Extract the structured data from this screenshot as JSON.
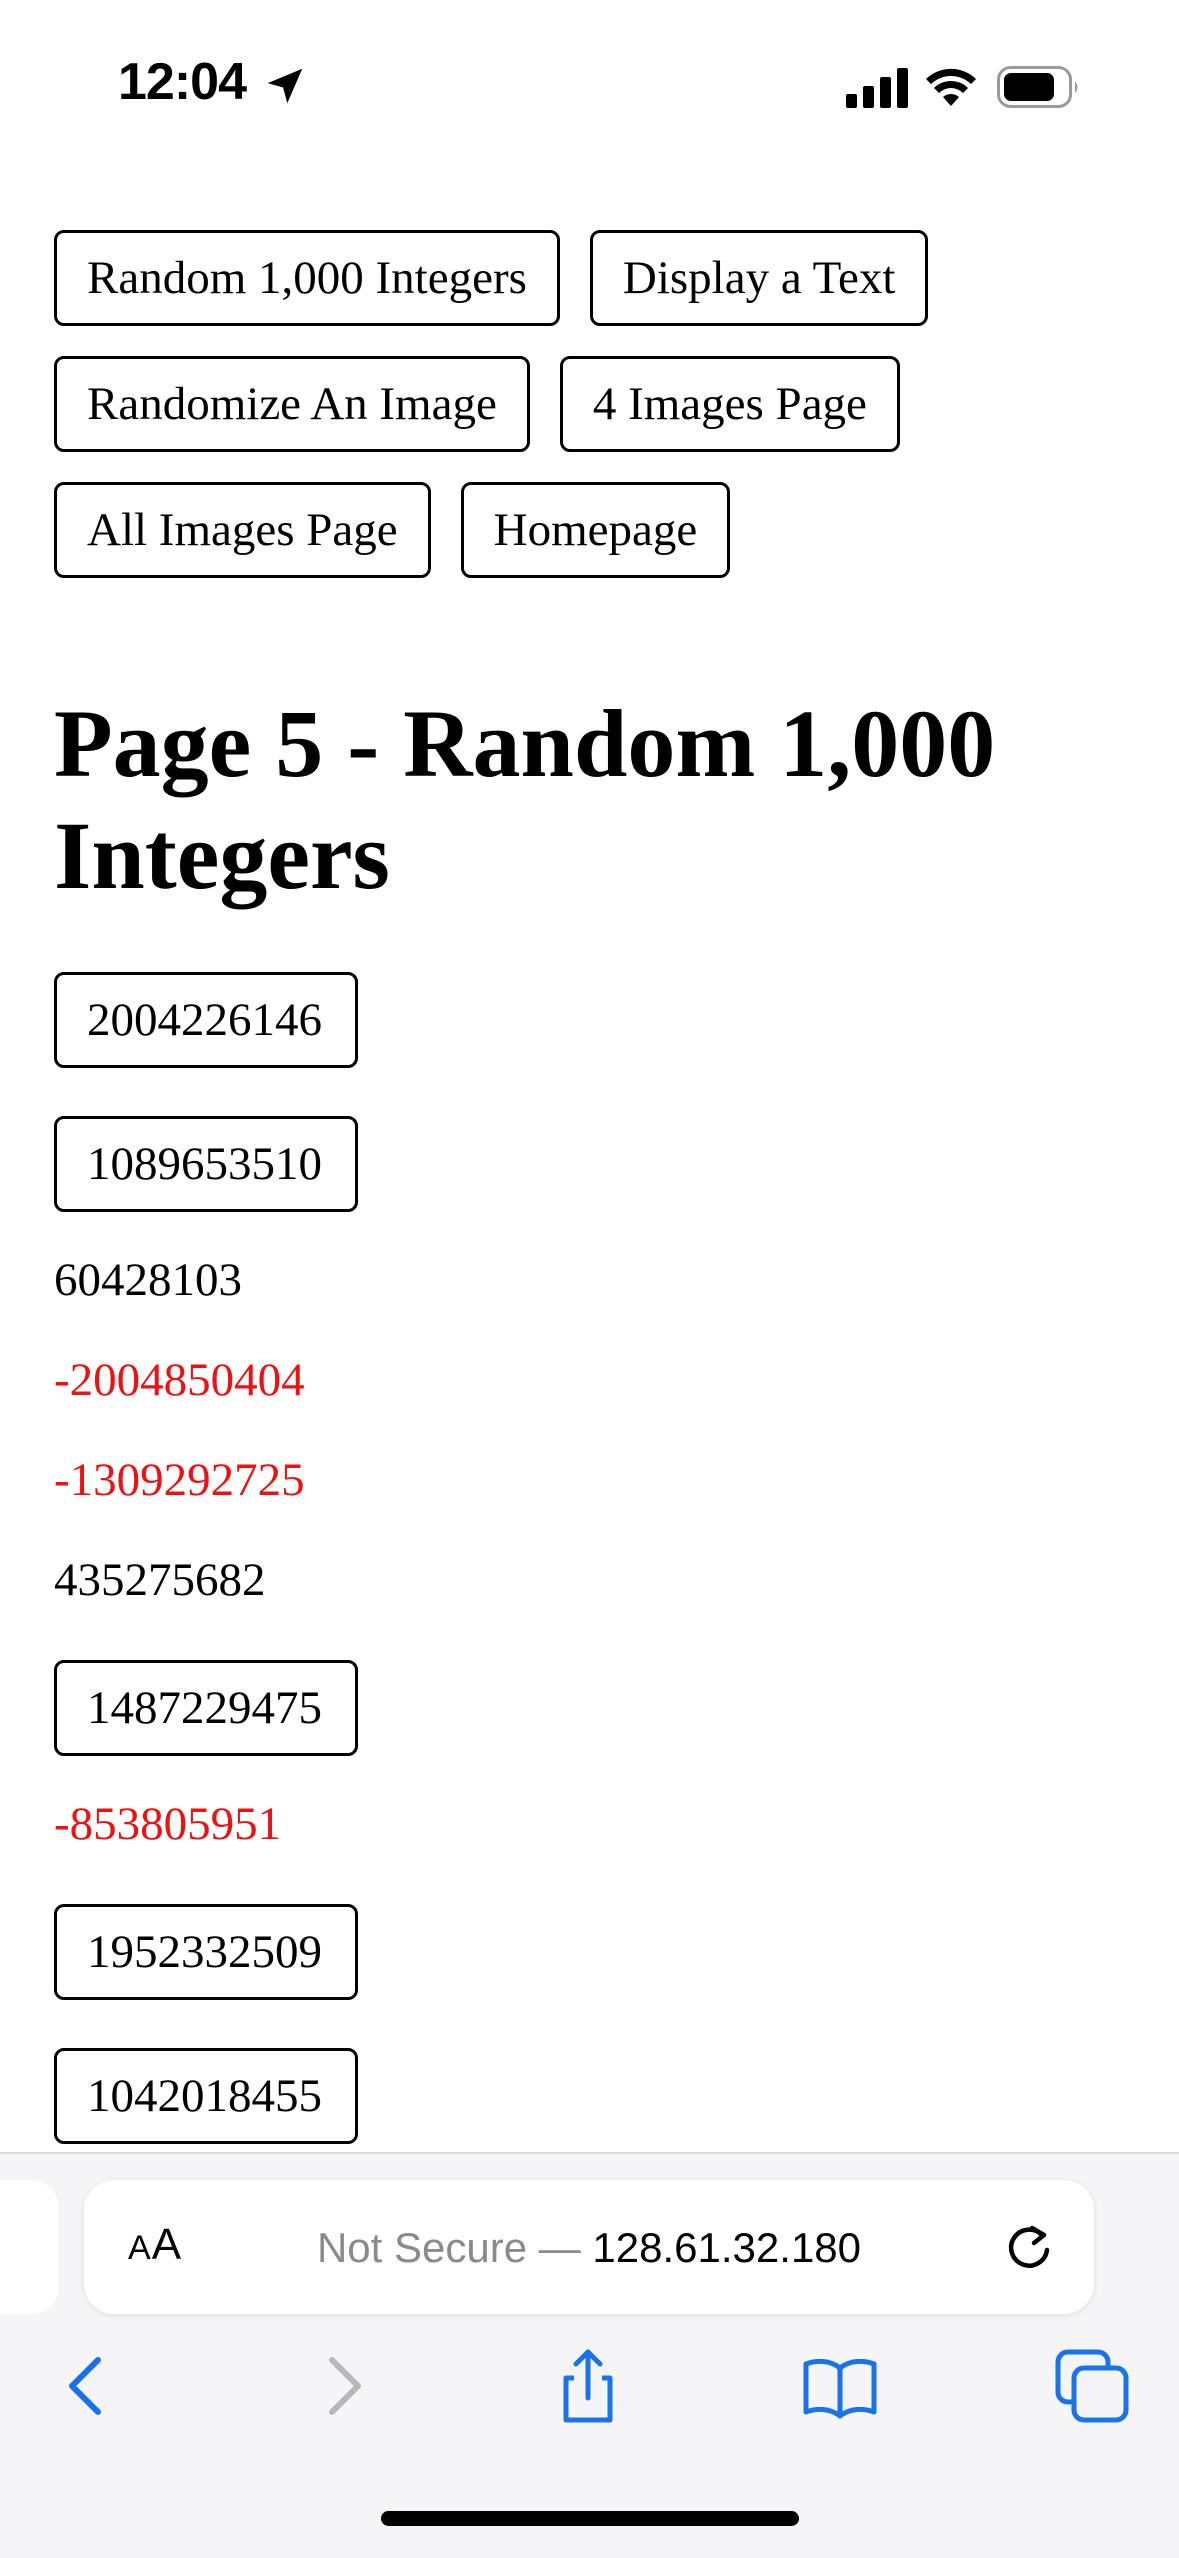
{
  "status_bar": {
    "time": "12:04"
  },
  "nav_buttons": [
    "Random 1,000 Integers",
    "Display a Text",
    "Randomize An Image",
    "4 Images Page",
    "All Images Page",
    "Homepage"
  ],
  "page_title": "Page 5 - Random 1,000 Integers",
  "numbers": [
    {
      "value": "2004226146",
      "style": "button"
    },
    {
      "value": "1089653510",
      "style": "button"
    },
    {
      "value": "60428103",
      "style": "text"
    },
    {
      "value": "-2004850404",
      "style": "negative"
    },
    {
      "value": "-1309292725",
      "style": "negative"
    },
    {
      "value": "435275682",
      "style": "text"
    },
    {
      "value": "1487229475",
      "style": "button"
    },
    {
      "value": "-853805951",
      "style": "negative"
    },
    {
      "value": "1952332509",
      "style": "button"
    },
    {
      "value": "1042018455",
      "style": "button"
    }
  ],
  "browser": {
    "aa_label_small": "A",
    "aa_label_large": "A",
    "url_prefix": "Not Secure — ",
    "url_host": "128.61.32.180",
    "accent_color": "#1a73e8",
    "negative_color": "#ee1111"
  },
  "toolbar_icons": [
    "back-icon",
    "forward-icon",
    "share-icon",
    "bookmarks-icon",
    "tabs-icon"
  ]
}
